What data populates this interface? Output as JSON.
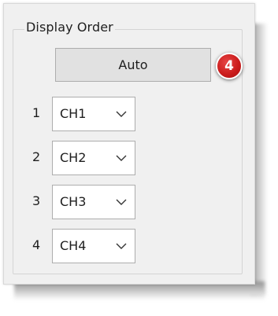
{
  "group": {
    "title": "Display Order"
  },
  "auto_button": {
    "label": "Auto"
  },
  "callout": {
    "number": "4",
    "color": "#cc1d1d"
  },
  "order_rows": [
    {
      "index": "1",
      "selected": "CH1",
      "icon": "chevron-down-icon"
    },
    {
      "index": "2",
      "selected": "CH2",
      "icon": "chevron-down-icon"
    },
    {
      "index": "3",
      "selected": "CH3",
      "icon": "chevron-down-icon"
    },
    {
      "index": "4",
      "selected": "CH4",
      "icon": "chevron-down-icon"
    }
  ]
}
